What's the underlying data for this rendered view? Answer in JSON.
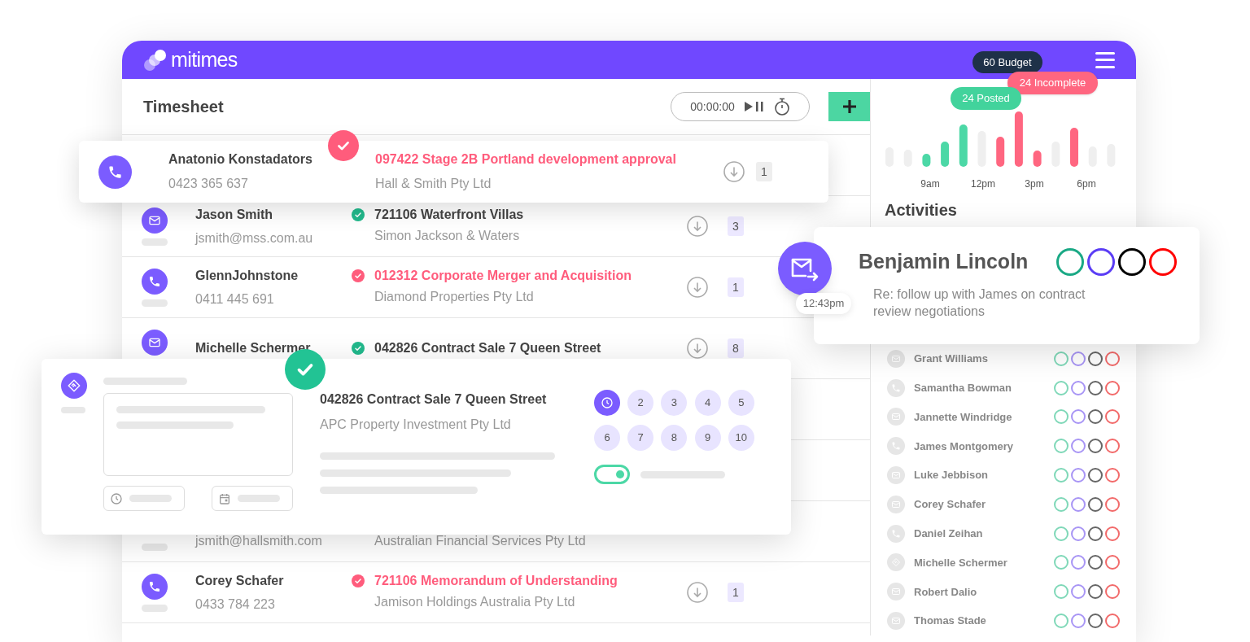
{
  "app": {
    "name": "mitimes"
  },
  "budget_badge": "60 Budget",
  "incomplete_badge": "24 Incomplete",
  "posted_badge": "24 Posted",
  "timesheet": {
    "title": "Timesheet",
    "timer": "00:00:00"
  },
  "featured_entry": {
    "kind": "phone",
    "name": "Anatonio Konstadators",
    "contact": "0423 365 637",
    "flagged": true,
    "color": "#ff5c7c",
    "title": "097422 Stage 2B Portland development approval",
    "client": "Hall & Smith Pty Ltd",
    "count": "1"
  },
  "entries": [
    {
      "kind": "mail",
      "name": "Jason Smith",
      "contact": "jsmith@mss.com.au",
      "flagged": false,
      "color": "#22b98c",
      "title": "721106 Waterfront Villas",
      "client": "Simon Jackson & Waters",
      "count": "3"
    },
    {
      "kind": "phone",
      "name": "GlennJohnstone",
      "contact": "0411 445 691",
      "flagged": true,
      "color": "#ff5c7c",
      "title": "012312 Corporate Merger and Acquisition",
      "client": "Diamond Properties Pty Ltd",
      "count": "1"
    },
    {
      "kind": "mail",
      "name": "Michelle Schermer",
      "flagged": false,
      "color": "#22b98c",
      "title": "042826 Contract Sale 7 Queen Street",
      "count": "8"
    },
    {
      "contact": "jsmith@hallsmith.com",
      "client": "Australian Financial Services Pty Ltd"
    },
    {
      "kind": "phone",
      "name": "Corey Schafer",
      "contact": "0433 784 223",
      "flagged": true,
      "color": "#ff5c7c",
      "title": "721106 Memorandum of Understanding",
      "client": "Jamison Holdings Australia Pty Ltd",
      "count": "1"
    }
  ],
  "detail": {
    "color": "#22c394",
    "title": "042826 Contract Sale 7 Queen Street",
    "client": "APC Property Investment Pty Ltd",
    "toggle_on": true,
    "slots": [
      {
        "kind": "clock",
        "selected": true
      },
      {
        "kind": "number",
        "label": "2",
        "selected": false
      },
      {
        "kind": "number",
        "label": "3",
        "selected": false
      },
      {
        "kind": "number",
        "label": "4",
        "selected": false
      },
      {
        "kind": "number",
        "label": "5",
        "selected": false
      },
      {
        "kind": "number",
        "label": "6",
        "selected": false
      },
      {
        "kind": "number",
        "label": "7",
        "selected": false
      },
      {
        "kind": "number",
        "label": "8",
        "selected": false
      },
      {
        "kind": "number",
        "label": "9",
        "selected": false
      },
      {
        "kind": "number",
        "label": "10",
        "selected": false
      }
    ]
  },
  "chart": {
    "x_labels": [
      "9am",
      "12pm",
      "3pm",
      "6pm"
    ]
  },
  "activities": {
    "title": "Activities",
    "items": [
      {
        "kind": "mail",
        "name": "Grant Williams"
      },
      {
        "kind": "phone",
        "name": "Samantha Bowman"
      },
      {
        "kind": "mail",
        "name": "Jannette Windridge"
      },
      {
        "kind": "phone",
        "name": "James Montgomery"
      },
      {
        "kind": "mail",
        "name": "Luke Jebbison"
      },
      {
        "kind": "mail",
        "name": "Corey Schafer"
      },
      {
        "kind": "phone",
        "name": "Daniel Zeihan"
      },
      {
        "kind": "meeting",
        "name": "Michelle Schermer"
      },
      {
        "kind": "mail",
        "name": "Robert Dalio"
      },
      {
        "kind": "mail",
        "name": "Thomas Stade"
      }
    ]
  },
  "notification": {
    "kind": "mail",
    "name": "Benjamin Lincoln",
    "message": "Re: follow up with James on contract review negotiations",
    "time": "12:43pm"
  }
}
